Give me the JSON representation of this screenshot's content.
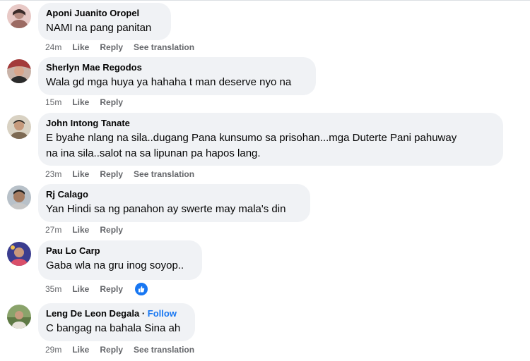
{
  "ui": {
    "like_label": "Like",
    "reply_label": "Reply",
    "see_translation_label": "See translation",
    "follow_label": "Follow",
    "name_separator": "·"
  },
  "colors": {
    "bubble_bg": "#f0f2f5",
    "meta_text": "#65676b",
    "link_blue": "#1877f2"
  },
  "comments": [
    {
      "author": "Aponi Juanito Oropel",
      "text": "NAMI na pang panitan",
      "time": "24m",
      "has_translation": true
    },
    {
      "author": "Sherlyn Mae Regodos",
      "text": "Wala gd mga huya ya hahaha t man deserve nyo na",
      "time": "15m",
      "has_translation": false
    },
    {
      "author": "John Intong Tanate",
      "text_line1": "E byahe nlang na sila..dugang Pana kunsumo sa prisohan...mga Duterte Pani pahuway",
      "text_line2": "na ina sila..salot na sa lipunan pa hapos lang.",
      "time": "23m",
      "has_translation": true
    },
    {
      "author": "Rj Calago",
      "text": "Yan Hindi sa ng panahon ay swerte may mala's din",
      "time": "27m",
      "has_translation": false
    },
    {
      "author": "Pau Lo Carp",
      "text": "Gaba wla na gru inog soyop..",
      "time": "35m",
      "has_translation": false,
      "reaction": "like-reaction-icon"
    },
    {
      "author": "Leng De Leon Degala",
      "text": "C bangag na bahala Sina ah",
      "time": "29m",
      "has_translation": true,
      "show_follow": true
    }
  ]
}
